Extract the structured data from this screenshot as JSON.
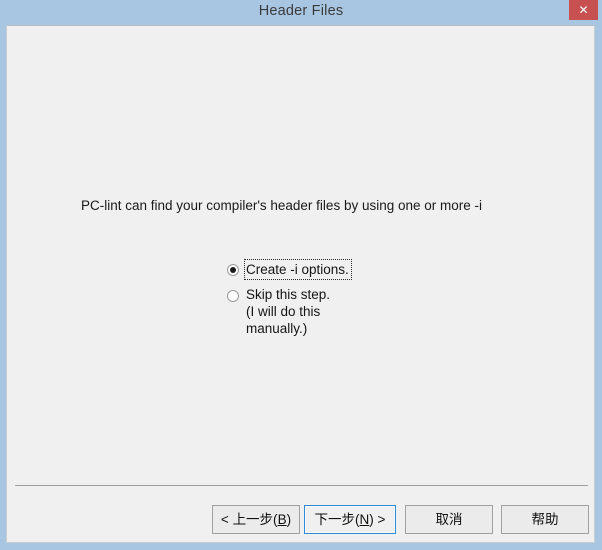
{
  "window": {
    "title": "Header Files",
    "close_icon": "close-icon",
    "close_glyph": "✕",
    "frame_color": "#a8c5e2",
    "client_bg": "#f0f0f0",
    "close_button_color": "#c75050"
  },
  "content": {
    "prompt": "PC-lint can find your compiler's header files by using one or more -i"
  },
  "options": {
    "items": [
      {
        "id": "create-i-options",
        "label": "Create -i options.",
        "selected": true,
        "focused": true,
        "sublines": []
      },
      {
        "id": "skip-this-step",
        "label": "Skip this step.",
        "selected": false,
        "focused": false,
        "sublines": [
          "(I will do this",
          "manually.)"
        ]
      }
    ]
  },
  "buttons": {
    "back": {
      "prefix": "< ",
      "text": "上一步(",
      "accel": "B",
      "suffix": ")"
    },
    "next": {
      "prefix": "",
      "text": "下一步(",
      "accel": "N",
      "suffix": ") >",
      "default": true,
      "accent": "#2e8bd8"
    },
    "cancel": {
      "text": "取消"
    },
    "help": {
      "text": "帮助"
    }
  }
}
